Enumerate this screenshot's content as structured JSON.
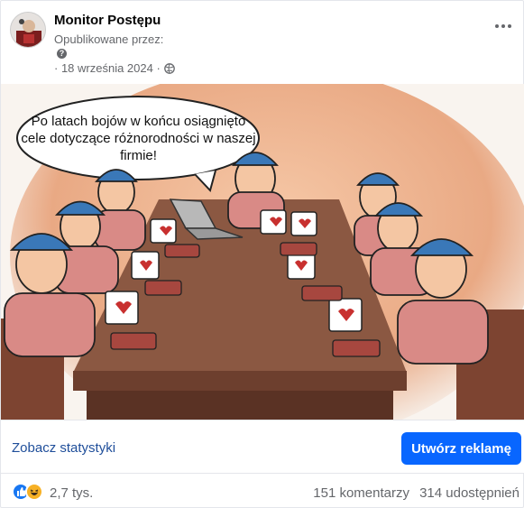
{
  "header": {
    "page_name": "Monitor Postępu",
    "published_by": "Opublikowane przez:",
    "date": "· 18 września 2024 ·"
  },
  "image": {
    "speech_bubble": "Po latach bojów w końcu osiągnięto cele dotyczące różnorodności w naszej firmie!"
  },
  "actions": {
    "see_stats": "Zobacz statystyki",
    "create_ad": "Utwórz reklamę"
  },
  "engagement": {
    "reactions": "2,7 tys.",
    "comments": "151 komentarzy",
    "shares": "314 udostępnień"
  },
  "colors": {
    "primary_button": "#0866ff",
    "link": "#1f4e9a",
    "secondary_text": "#65676b"
  },
  "icons": [
    "info-icon",
    "globe-icon",
    "more-icon",
    "like-icon",
    "haha-icon"
  ]
}
